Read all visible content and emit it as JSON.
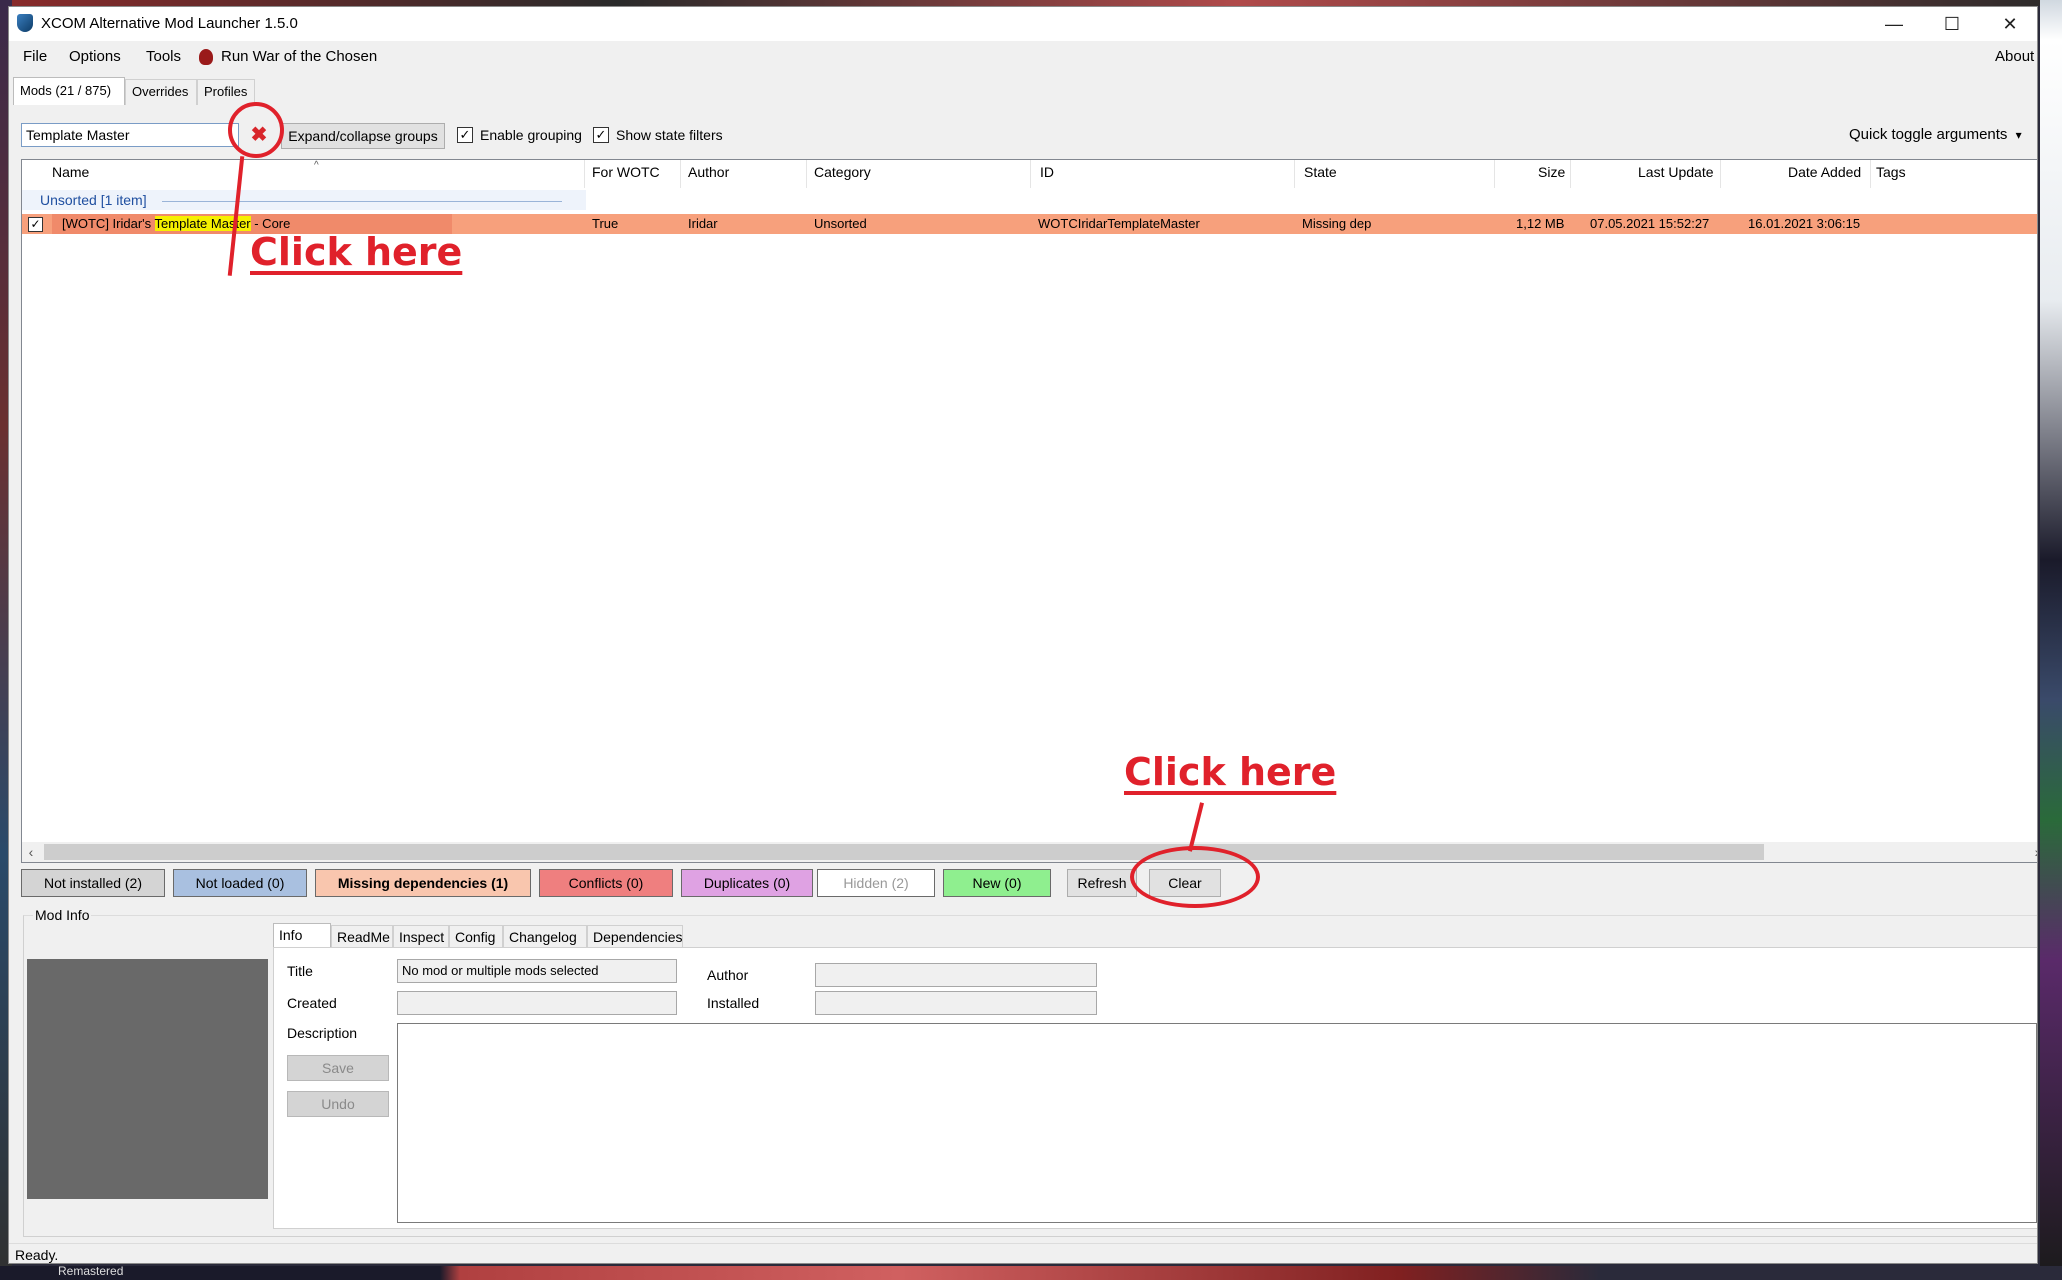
{
  "window": {
    "title": "XCOM Alternative Mod Launcher 1.5.0",
    "minimize_icon": "minimize-icon",
    "maximize_icon": "maximize-icon",
    "close_icon": "close-icon"
  },
  "menu": {
    "file": "File",
    "options": "Options",
    "tools": "Tools",
    "run": "Run War of the Chosen",
    "about": "About"
  },
  "tabs": [
    "Mods (21 / 875)",
    "Overrides",
    "Profiles"
  ],
  "toolbar": {
    "search_value": "Template Master",
    "expand_collapse": "Expand/collapse groups",
    "enable_grouping": "Enable grouping",
    "show_state_filters": "Show state filters",
    "quick_toggle": "Quick toggle arguments",
    "quick_toggle_arrow": "▾"
  },
  "columns": [
    "Name",
    "For WOTC",
    "Author",
    "Category",
    "ID",
    "State",
    "Size",
    "Last Update",
    "Date Added",
    "Tags"
  ],
  "group": {
    "label": "Unsorted [1 item]"
  },
  "row": {
    "checked": true,
    "check_mark": "✓",
    "name_prefix": "[WOTC] Iridar's ",
    "name_highlight": "Template Master",
    "name_suffix": " - Core",
    "for_wotc": "True",
    "author": "Iridar",
    "category": "Unsorted",
    "id": "WOTCIridarTemplateMaster",
    "state": "Missing dep",
    "size": "1,12 MB",
    "last_update": "07.05.2021 15:52:27",
    "date_added": "16.01.2021 3:06:15",
    "tags": ""
  },
  "filters": [
    {
      "label": "Not installed (2)",
      "color": "#d4d4d4"
    },
    {
      "label": "Not loaded (0)",
      "color": "#a9c0e0"
    },
    {
      "label": "Missing dependencies (1)",
      "color": "#f9c6ae"
    },
    {
      "label": "Conflicts (0)",
      "color": "#ef7f7f"
    },
    {
      "label": "Duplicates (0)",
      "color": "#dfa2e3"
    },
    {
      "label": "Hidden (2)",
      "color": "#ffffff"
    },
    {
      "label": "New (0)",
      "color": "#8fef8f"
    }
  ],
  "filter_buttons": {
    "refresh": "Refresh",
    "clear": "Clear"
  },
  "mod_info": {
    "group_label": "Mod Info",
    "tabs": [
      "Info",
      "ReadMe",
      "Inspect",
      "Config",
      "Changelog",
      "Dependencies"
    ],
    "title_label": "Title",
    "title_value": "No mod or multiple mods selected",
    "author_label": "Author",
    "created_label": "Created",
    "installed_label": "Installed",
    "description_label": "Description",
    "save": "Save",
    "undo": "Undo"
  },
  "status": "Ready.",
  "annotations": {
    "click_here_1": "Click here",
    "click_here_2": "Click here",
    "color": "#e0212b"
  },
  "desktop": {
    "taskbar_text": "Remastered"
  }
}
